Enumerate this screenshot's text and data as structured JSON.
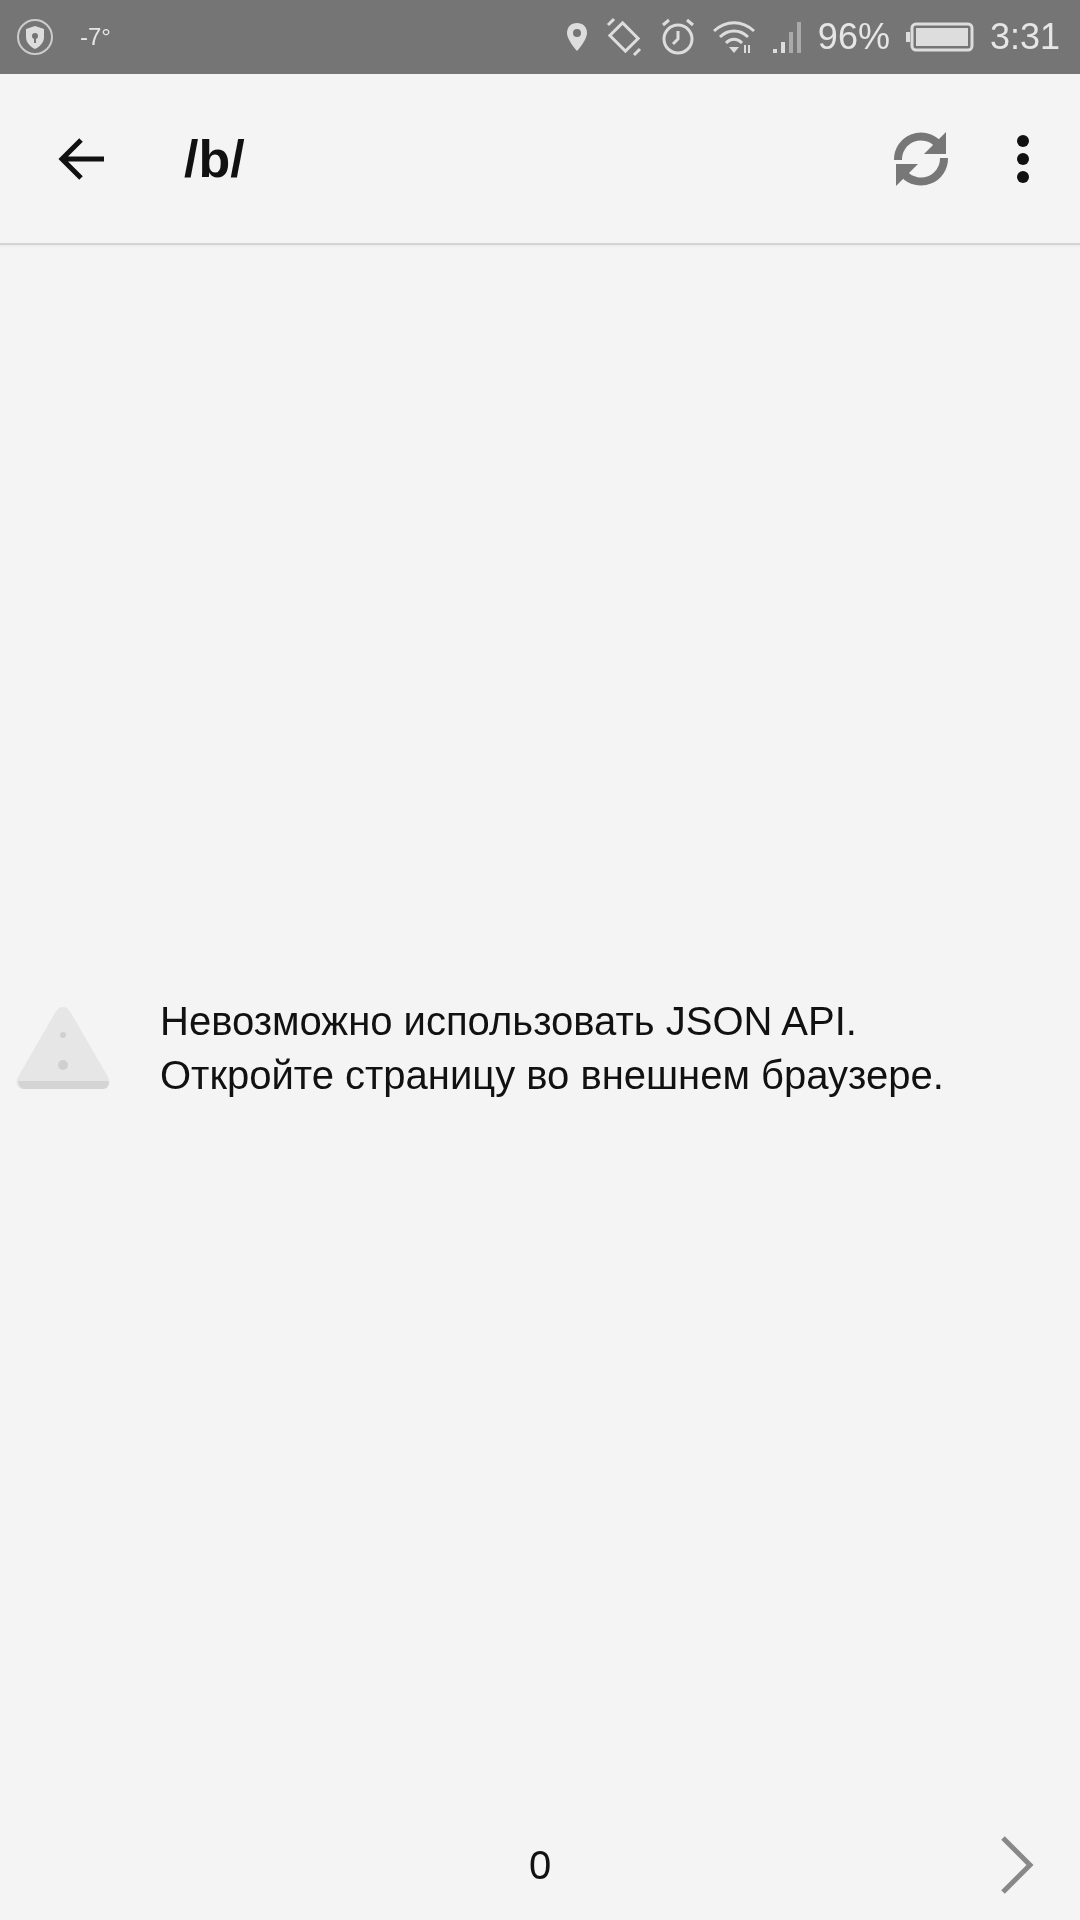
{
  "status_bar": {
    "temperature": "-7°",
    "battery": "96%",
    "time": "3:31"
  },
  "toolbar": {
    "title": "/b/"
  },
  "message": {
    "lines": [
      "Невозможно использовать JSON API.",
      "Откройте страницу во внешнем браузере."
    ]
  },
  "pager": {
    "page": "0"
  }
}
